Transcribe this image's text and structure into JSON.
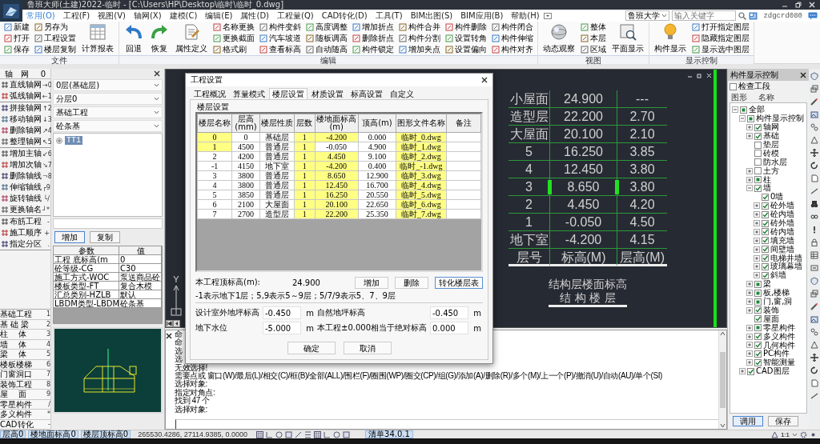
{
  "window": {
    "title": "鲁班大师(土建)2022-临时 - [C:\\Users\\HP\\Desktop\\临时\\临时_0.dwg]"
  },
  "menu": [
    {
      "label": "常用(O)",
      "selected": true
    },
    {
      "label": "工程(F)",
      "selected": false
    },
    {
      "label": "视图(V)",
      "selected": false
    },
    {
      "label": "轴网(X)",
      "selected": false
    },
    {
      "label": "建模(C)",
      "selected": false
    },
    {
      "label": "编辑(E)",
      "selected": false
    },
    {
      "label": "属性(D)",
      "selected": false
    },
    {
      "label": "工程量(Q)",
      "selected": false
    },
    {
      "label": "CAD转化(D)",
      "selected": false
    },
    {
      "label": "工具(T)",
      "selected": false
    },
    {
      "label": "BIM出图(S)",
      "selected": false
    },
    {
      "label": "BIM应用(B)",
      "selected": false
    },
    {
      "label": "帮助(H)",
      "selected": false
    }
  ],
  "search": {
    "site": "鲁班大学",
    "placeholder": "输入关键字"
  },
  "user": {
    "name": "zdgcrd080"
  },
  "ribbon": [
    {
      "title": "文件",
      "columns": [
        {
          "kind": "stack",
          "items": [
            "新建",
            "打开",
            "保存"
          ]
        },
        {
          "kind": "stack",
          "items": [
            "另存为",
            "工程设置",
            "楼层复制"
          ]
        },
        {
          "kind": "large",
          "label": "计算报表"
        }
      ]
    },
    {
      "title": "编辑",
      "columns": [
        {
          "kind": "large",
          "label": "回退"
        },
        {
          "kind": "large",
          "label": "恢复"
        },
        {
          "kind": "large",
          "label": "属性定义"
        },
        {
          "kind": "stack",
          "items": [
            "名称更换",
            "更换截面",
            "格式刷"
          ]
        },
        {
          "kind": "stack",
          "items": [
            "构件变斜",
            "汽车坡道",
            "查看标高"
          ]
        },
        {
          "kind": "stack",
          "items": [
            "高度调整",
            "随板调高",
            "自动随高"
          ]
        },
        {
          "kind": "stack",
          "items": [
            "增加折点",
            "删除折点",
            "构件锁定"
          ]
        },
        {
          "kind": "stack",
          "items": [
            "构件合并",
            "构件分割",
            "增加夹点"
          ]
        },
        {
          "kind": "stack",
          "items": [
            "构件删除",
            "设置转角",
            "设置偏向"
          ]
        },
        {
          "kind": "stack",
          "items": [
            "构件闭合",
            "构件伸缩",
            "构件对齐"
          ]
        }
      ]
    },
    {
      "title": "视图",
      "columns": [
        {
          "kind": "large",
          "label": "动态观察"
        },
        {
          "kind": "stack",
          "items": [
            "整体",
            "本层",
            "区域"
          ]
        },
        {
          "kind": "large",
          "label": "平面显示"
        }
      ]
    },
    {
      "title": "显示控制",
      "columns": [
        {
          "kind": "large",
          "label": "构件显示"
        },
        {
          "kind": "stack",
          "items": [
            "打开指定图层",
            "隐藏指定图层",
            "显示选中图层"
          ]
        }
      ]
    }
  ],
  "axis_tools": {
    "title": "轴　网",
    "key": "0",
    "groups": [
      [
        {
          "label": "直线轴网",
          "key": "→0"
        },
        {
          "label": "弧线轴网",
          "key": "←1"
        }
      ],
      [
        {
          "label": "拼接轴网",
          "key": "↑2"
        },
        {
          "label": "移动轴网",
          "key": "↓3"
        },
        {
          "label": "删除轴网",
          "key": "↗4"
        },
        {
          "label": "整理轴网",
          "key": "↖5"
        }
      ],
      [
        {
          "label": "增加主轴",
          "key": "↙6"
        },
        {
          "label": "增加次轴",
          "key": "↘7"
        },
        {
          "label": "删除轴线",
          "key": "¬8"
        },
        {
          "label": "伸缩轴线",
          "key": "┌9"
        },
        {
          "label": "旋转轴线",
          "key": "└/"
        },
        {
          "label": "更换轴名",
          "key": "┘*"
        }
      ],
      [
        {
          "label": "布筋工程",
          "key": "-"
        },
        {
          "label": "施工顺序",
          "key": "+"
        },
        {
          "label": "指定分区",
          "key": "."
        }
      ]
    ]
  },
  "modules": [
    {
      "label": "基础工程",
      "key": "1"
    },
    {
      "label": "基 础 梁",
      "key": "2"
    },
    {
      "label": "柱　 体",
      "key": "3"
    },
    {
      "label": "墙　 体",
      "key": "4"
    },
    {
      "label": "梁　 体",
      "key": "5"
    },
    {
      "label": "楼板楼梯",
      "key": "6"
    },
    {
      "label": "门窗洞口",
      "key": "7"
    },
    {
      "label": "装饰工程",
      "key": "8"
    },
    {
      "label": "屋　 面",
      "key": "9"
    },
    {
      "label": "零星构件",
      "key": "/"
    },
    {
      "label": "多义构件",
      "key": "*"
    },
    {
      "label": "CAD转化",
      "key": "-"
    }
  ],
  "left_panel": {
    "floor": "0层(基础层)",
    "sublayer": "分层0",
    "category": "基础工程",
    "type": "砼条基",
    "tree": [
      {
        "label": "TT1",
        "selected": true
      }
    ],
    "buttons": [
      "增加",
      "复制"
    ],
    "params_header": [
      "参数",
      "值"
    ],
    "params": [
      [
        "工程 底标高(m",
        "0"
      ],
      [
        "砼等级-CG",
        "C30"
      ],
      [
        "施工方式-WOC",
        "泵送商品砼"
      ],
      [
        "楼板类型-FT",
        "复合木模"
      ],
      [
        "汇总类别-HZLB",
        "默认"
      ],
      [
        "LBDM类型-LBDM",
        "砼条基"
      ]
    ]
  },
  "canvas": {
    "floor_table": {
      "rows": [
        {
          "cells": [
            "小屋面",
            "24.900",
            "---"
          ],
          "marked": false
        },
        {
          "cells": [
            "造型层",
            "22.200",
            "2.70"
          ],
          "marked": false
        },
        {
          "cells": [
            "大屋面",
            "20.100",
            "2.10"
          ],
          "marked": false
        },
        {
          "cells": [
            "5",
            "16.250",
            "3.85"
          ],
          "marked": false
        },
        {
          "cells": [
            "4",
            "12.450",
            "3.80"
          ],
          "marked": false
        },
        {
          "cells": [
            "3",
            "8.650",
            "3.80"
          ],
          "marked": true
        },
        {
          "cells": [
            "2",
            "4.450",
            "4.20"
          ],
          "marked": false
        },
        {
          "cells": [
            "1",
            "-0.050",
            "4.50"
          ],
          "marked": false
        },
        {
          "cells": [
            "地下室",
            "-4.200",
            "4.15"
          ],
          "marked": false
        }
      ],
      "header": [
        "层号",
        "标高(M)",
        "层高(M)"
      ]
    },
    "caption": [
      "结构层楼面标高",
      "结 构 楼 层"
    ],
    "axis_label": "Y"
  },
  "dialog": {
    "title": "工程设置",
    "tabs": [
      {
        "label": "工程概况",
        "selected": false
      },
      {
        "label": "算量模式",
        "selected": false
      },
      {
        "label": "楼层设置",
        "selected": true
      },
      {
        "label": "材质设置",
        "selected": false
      },
      {
        "label": "标高设置",
        "selected": false
      },
      {
        "label": "自定义",
        "selected": false
      }
    ],
    "group": "楼层设置",
    "floor_table": {
      "columns": [
        "楼层名称",
        "层高(mm)",
        "楼层性质",
        "层数",
        "楼地面标高(m)",
        "顶高(m)",
        "图形文件名称",
        "备注"
      ],
      "rows": [
        {
          "cells": [
            {
              "text": "0",
              "highlighted": true
            },
            {
              "text": "0",
              "highlighted": false
            },
            {
              "text": "基础层",
              "highlighted": false
            },
            {
              "text": "1",
              "highlighted": true
            },
            {
              "text": "-4.200",
              "highlighted": true
            },
            {
              "text": "0.000",
              "highlighted": false
            },
            {
              "text": "临时_0.dwg",
              "highlighted": true
            },
            {
              "text": "",
              "highlighted": false
            }
          ]
        },
        {
          "cells": [
            {
              "text": "1",
              "highlighted": true
            },
            {
              "text": "4500",
              "highlighted": false
            },
            {
              "text": "普通层",
              "highlighted": false
            },
            {
              "text": "1",
              "highlighted": true
            },
            {
              "text": "-0.050",
              "highlighted": false
            },
            {
              "text": "4.900",
              "highlighted": false
            },
            {
              "text": "临时_1.dwg",
              "highlighted": true
            },
            {
              "text": "",
              "highlighted": false
            }
          ]
        },
        {
          "cells": [
            {
              "text": "2",
              "highlighted": false
            },
            {
              "text": "4200",
              "highlighted": false
            },
            {
              "text": "普通层",
              "highlighted": false
            },
            {
              "text": "1",
              "highlighted": true
            },
            {
              "text": "4.450",
              "highlighted": true
            },
            {
              "text": "9.100",
              "highlighted": false
            },
            {
              "text": "临时_2.dwg",
              "highlighted": true
            },
            {
              "text": "",
              "highlighted": false
            }
          ]
        },
        {
          "cells": [
            {
              "text": "-1",
              "highlighted": false
            },
            {
              "text": "4150",
              "highlighted": false
            },
            {
              "text": "地下室",
              "highlighted": false
            },
            {
              "text": "1",
              "highlighted": true
            },
            {
              "text": "-4.200",
              "highlighted": true
            },
            {
              "text": "0.400",
              "highlighted": false
            },
            {
              "text": "临时_-1.dwg",
              "highlighted": true
            },
            {
              "text": "",
              "highlighted": false
            }
          ]
        },
        {
          "cells": [
            {
              "text": "3",
              "highlighted": false
            },
            {
              "text": "3800",
              "highlighted": false
            },
            {
              "text": "普通层",
              "highlighted": false
            },
            {
              "text": "1",
              "highlighted": true
            },
            {
              "text": "8.650",
              "highlighted": true
            },
            {
              "text": "12.900",
              "highlighted": false
            },
            {
              "text": "临时_3.dwg",
              "highlighted": true
            },
            {
              "text": "",
              "highlighted": false
            }
          ]
        },
        {
          "cells": [
            {
              "text": "4",
              "highlighted": false
            },
            {
              "text": "3800",
              "highlighted": false
            },
            {
              "text": "普通层",
              "highlighted": false
            },
            {
              "text": "1",
              "highlighted": true
            },
            {
              "text": "12.450",
              "highlighted": true
            },
            {
              "text": "16.700",
              "highlighted": false
            },
            {
              "text": "临时_4.dwg",
              "highlighted": true
            },
            {
              "text": "",
              "highlighted": false
            }
          ]
        },
        {
          "cells": [
            {
              "text": "5",
              "highlighted": false
            },
            {
              "text": "3850",
              "highlighted": false
            },
            {
              "text": "普通层",
              "highlighted": false
            },
            {
              "text": "1",
              "highlighted": true
            },
            {
              "text": "16.250",
              "highlighted": true
            },
            {
              "text": "20.550",
              "highlighted": false
            },
            {
              "text": "临时_5.dwg",
              "highlighted": true
            },
            {
              "text": "",
              "highlighted": false
            }
          ]
        },
        {
          "cells": [
            {
              "text": "6",
              "highlighted": false
            },
            {
              "text": "2100",
              "highlighted": false
            },
            {
              "text": "大屋面",
              "highlighted": false
            },
            {
              "text": "1",
              "highlighted": true
            },
            {
              "text": "20.100",
              "highlighted": true
            },
            {
              "text": "22.650",
              "highlighted": false
            },
            {
              "text": "临时_6.dwg",
              "highlighted": true
            },
            {
              "text": "",
              "highlighted": false
            }
          ]
        },
        {
          "cells": [
            {
              "text": "7",
              "highlighted": false
            },
            {
              "text": "2700",
              "highlighted": false
            },
            {
              "text": "造型层",
              "highlighted": false
            },
            {
              "text": "1",
              "highlighted": true
            },
            {
              "text": "22.200",
              "highlighted": true
            },
            {
              "text": "25.350",
              "highlighted": false
            },
            {
              "text": "临时_7.dwg",
              "highlighted": true
            },
            {
              "text": "",
              "highlighted": false
            }
          ]
        }
      ]
    },
    "top_label": "本工程顶标高(m):",
    "top_value": "24.900",
    "table_buttons": [
      "增加",
      "删除",
      "转化楼层表"
    ],
    "note": "-1表示地下1层；5,9表示5～9层；5/7/9表示5、7、9层",
    "fields": [
      {
        "label": "设计室外地坪标高",
        "value": "-0.450",
        "unit": "m"
      },
      {
        "label": "自然地坪标高",
        "value": "-0.450",
        "unit": "m"
      },
      {
        "label": "地下水位",
        "value": "-5.000",
        "unit": "m"
      },
      {
        "label": "本工程±0.000相当于绝对标高",
        "value": "0.000",
        "unit": "m"
      }
    ],
    "buttons": [
      "确定",
      "取消"
    ]
  },
  "command": {
    "lines": [
      "命",
      "命",
      "选",
      "选",
      "无效选择!",
      "需要点或 窗口(W)/最后(L)/相交(C)/框(B)/全部(ALL)/围栏(F)/圈围(WP)/圈交(CP)/组(G)/添加(A)/删除(R)/多个(M)/上一个(P)/撤消(U)/自动(AU)/单个(SI)",
      "选择对象:",
      "指定对角点:",
      "找到 47 个",
      "选择对象:"
    ]
  },
  "right_panel": {
    "title": "构件显示控制",
    "check_sections": {
      "label": "检查工段",
      "checked": false
    },
    "columns": [
      "图形",
      "名称"
    ],
    "tree": [
      {
        "label": "全部",
        "kind": "group",
        "expanded": true,
        "checked": false,
        "partial": true,
        "children": [
          {
            "label": "构件显示控制",
            "kind": "group",
            "expanded": true,
            "checked": false,
            "partial": true,
            "children": [
              {
                "label": "轴网",
                "kind": "group",
                "expanded": false,
                "checked": true,
                "partial": false
              },
              {
                "label": "基础",
                "kind": "group",
                "expanded": false,
                "checked": true,
                "partial": false
              },
              {
                "label": "垫层",
                "kind": "leaf",
                "checked": false,
                "partial": false
              },
              {
                "label": "砖模",
                "kind": "leaf",
                "checked": false,
                "partial": false
              },
              {
                "label": "防水层",
                "kind": "leaf",
                "checked": false,
                "partial": false
              },
              {
                "label": "土方",
                "kind": "group",
                "expanded": false,
                "checked": false,
                "partial": false
              },
              {
                "label": "柱",
                "kind": "group",
                "expanded": false,
                "checked": false,
                "partial": true
              },
              {
                "label": "墙",
                "kind": "group",
                "expanded": true,
                "checked": true,
                "partial": false,
                "children": [
                  {
                    "label": "0墙",
                    "kind": "leaf",
                    "checked": true,
                    "partial": false
                  },
                  {
                    "label": "砼外墙",
                    "kind": "group",
                    "expanded": false,
                    "checked": true,
                    "partial": false
                  },
                  {
                    "label": "砼内墙",
                    "kind": "group",
                    "expanded": false,
                    "checked": true,
                    "partial": false
                  },
                  {
                    "label": "砖外墙",
                    "kind": "group",
                    "expanded": false,
                    "checked": true,
                    "partial": false
                  },
                  {
                    "label": "砖内墙",
                    "kind": "group",
                    "expanded": false,
                    "checked": true,
                    "partial": false
                  },
                  {
                    "label": "填充墙",
                    "kind": "group",
                    "expanded": false,
                    "checked": true,
                    "partial": false
                  },
                  {
                    "label": "间壁墙",
                    "kind": "group",
                    "expanded": false,
                    "checked": true,
                    "partial": false
                  },
                  {
                    "label": "电梯井墙",
                    "kind": "group",
                    "expanded": false,
                    "checked": true,
                    "partial": false
                  },
                  {
                    "label": "玻璃幕墙",
                    "kind": "group",
                    "expanded": false,
                    "checked": true,
                    "partial": false
                  },
                  {
                    "label": "斜墙",
                    "kind": "group",
                    "expanded": false,
                    "checked": true,
                    "partial": false
                  }
                ]
              },
              {
                "label": "梁",
                "kind": "group",
                "expanded": false,
                "checked": false,
                "partial": true
              },
              {
                "label": "板,楼梯",
                "kind": "group",
                "expanded": false,
                "checked": false,
                "partial": true
              },
              {
                "label": "门,窗,洞",
                "kind": "group",
                "expanded": false,
                "checked": false,
                "partial": true
              },
              {
                "label": "装饰",
                "kind": "group",
                "expanded": false,
                "checked": true,
                "partial": false
              },
              {
                "label": "屋面",
                "kind": "leaf",
                "checked": true,
                "partial": false
              },
              {
                "label": "零星构件",
                "kind": "group",
                "expanded": false,
                "checked": false,
                "partial": true
              },
              {
                "label": "多义构件",
                "kind": "group",
                "expanded": false,
                "checked": true,
                "partial": false
              },
              {
                "label": "几何构件",
                "kind": "group",
                "expanded": false,
                "checked": true,
                "partial": false
              },
              {
                "label": "PC构件",
                "kind": "group",
                "expanded": false,
                "checked": true,
                "partial": false
              },
              {
                "label": "智能测量",
                "kind": "group",
                "expanded": false,
                "checked": true,
                "partial": false
              }
            ]
          },
          {
            "label": "CAD图层",
            "kind": "group",
            "expanded": false,
            "checked": true,
            "partial": false
          }
        ]
      }
    ],
    "buttons": [
      "调用",
      "保存"
    ]
  },
  "status_bar": {
    "fields": [
      "层高0",
      "楼地面标高0",
      "楼层顶标高0"
    ],
    "coordinates": "265530.4286, 27114.9385, 0.0000",
    "version": "清单34.0.1",
    "scale": "1:1"
  }
}
